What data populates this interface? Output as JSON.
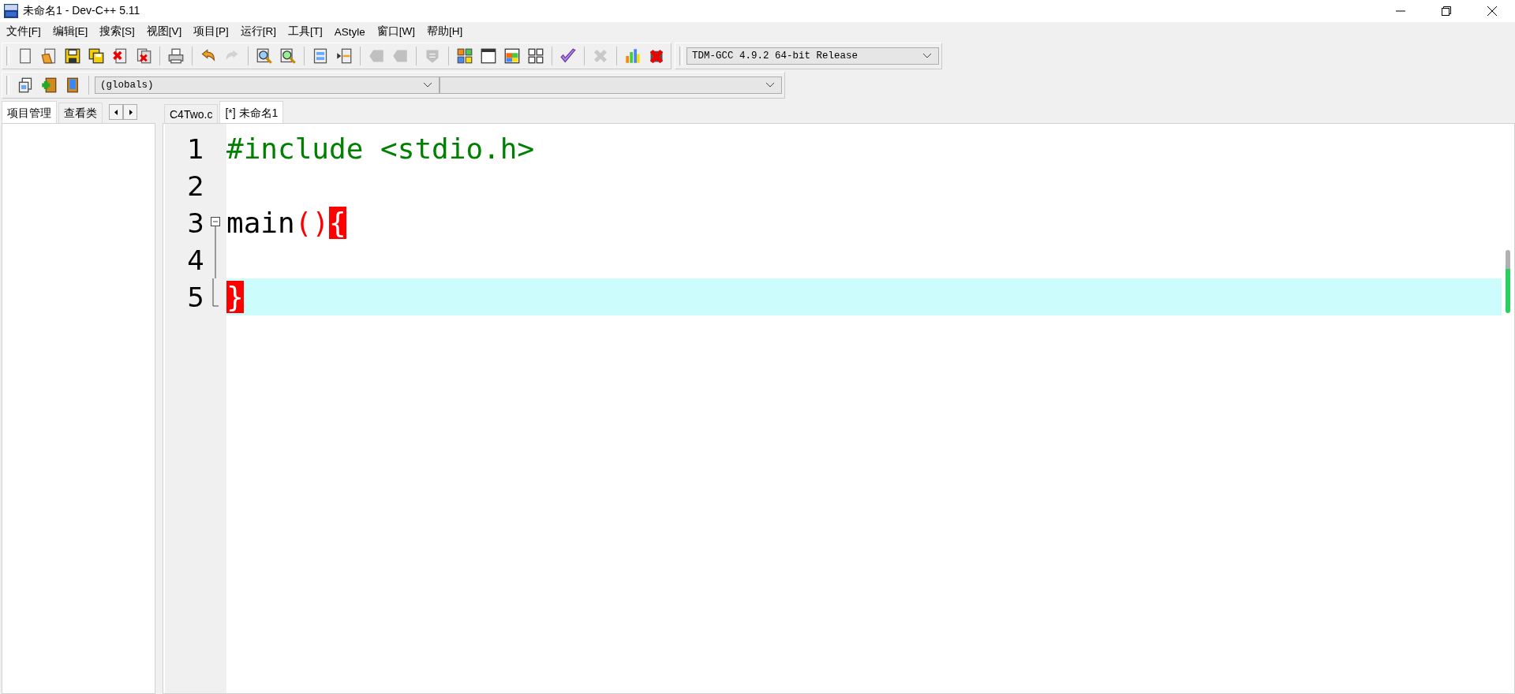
{
  "window": {
    "title": "未命名1 - Dev-C++ 5.11"
  },
  "menu": [
    "文件[F]",
    "编辑[E]",
    "搜索[S]",
    "视图[V]",
    "项目[P]",
    "运行[R]",
    "工具[T]",
    "AStyle",
    "窗口[W]",
    "帮助[H]"
  ],
  "toolbar": [
    {
      "kind": "new",
      "disabled": false
    },
    {
      "kind": "open",
      "disabled": false
    },
    {
      "kind": "save",
      "disabled": false
    },
    {
      "kind": "saveall",
      "disabled": false
    },
    {
      "kind": "close",
      "disabled": false
    },
    {
      "kind": "closeall",
      "disabled": false
    },
    {
      "kind": "sep"
    },
    {
      "kind": "print",
      "disabled": false
    },
    {
      "kind": "sep"
    },
    {
      "kind": "undo",
      "disabled": false
    },
    {
      "kind": "redo",
      "disabled": true
    },
    {
      "kind": "sep"
    },
    {
      "kind": "find",
      "disabled": false
    },
    {
      "kind": "replace",
      "disabled": false
    },
    {
      "kind": "sep"
    },
    {
      "kind": "listwin",
      "disabled": false
    },
    {
      "kind": "indent",
      "disabled": false
    },
    {
      "kind": "sep"
    },
    {
      "kind": "bookmark",
      "disabled": true
    },
    {
      "kind": "bookmark",
      "disabled": true
    },
    {
      "kind": "sep"
    },
    {
      "kind": "comment",
      "disabled": true
    },
    {
      "kind": "sep"
    },
    {
      "kind": "colorgrid",
      "disabled": false
    },
    {
      "kind": "window",
      "disabled": false
    },
    {
      "kind": "colorwindow",
      "disabled": false
    },
    {
      "kind": "grid",
      "disabled": false
    },
    {
      "kind": "sep"
    },
    {
      "kind": "check",
      "disabled": false
    },
    {
      "kind": "sep"
    },
    {
      "kind": "stop",
      "disabled": true
    },
    {
      "kind": "sep"
    },
    {
      "kind": "chart",
      "disabled": false
    },
    {
      "kind": "debugx",
      "disabled": false
    }
  ],
  "compiler": {
    "value": "TDM-GCC 4.9.2 64-bit Release"
  },
  "toolbar2": [
    {
      "kind": "copypages",
      "disabled": false
    },
    {
      "kind": "plusbox",
      "disabled": false
    },
    {
      "kind": "book",
      "disabled": false
    }
  ],
  "scope": {
    "value": "(globals)"
  },
  "side_tabs": [
    {
      "label": "项目管理",
      "selected": true
    },
    {
      "label": "查看类",
      "selected": false
    }
  ],
  "editor_tabs": [
    {
      "label": "C4Two.c",
      "selected": false
    },
    {
      "label": "[*] 未命名1",
      "selected": true
    }
  ],
  "lines": [
    {
      "number": "1",
      "current": false,
      "kind": "plain",
      "tokens": [
        {
          "kind": "preprocessor",
          "text": "#include <stdio.h>"
        }
      ]
    },
    {
      "number": "2",
      "current": false,
      "kind": "plain"
    },
    {
      "number": "3",
      "current": false,
      "kind": "foldstart",
      "tokens": [
        {
          "kind": "plain",
          "text": "main"
        },
        {
          "kind": "paren",
          "text": "()"
        },
        {
          "kind": "brace",
          "text": "{"
        }
      ]
    },
    {
      "number": "4",
      "current": false,
      "kind": "foldline"
    },
    {
      "number": "5",
      "current": true,
      "kind": "foldend",
      "tokens": [
        {
          "kind": "brace",
          "text": "}"
        }
      ]
    }
  ]
}
